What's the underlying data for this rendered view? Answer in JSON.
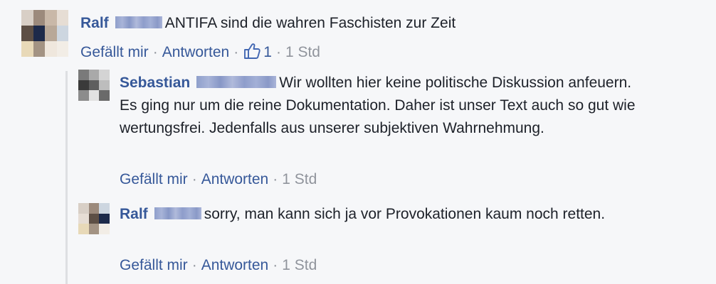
{
  "comments": [
    {
      "author": "Ralf",
      "text": "ANTIFA sind die wahren Faschisten zur Zeit",
      "actions": {
        "like": "Gefällt mir",
        "reply": "Antworten",
        "like_count": "1",
        "time": "1 Std"
      },
      "avatar_colors": [
        "#d8cfc6",
        "#9c8a7c",
        "#c9b8a8",
        "#e6ddd4",
        "#5d4f45",
        "#1d2a4a",
        "#b8a898",
        "#cdd6e0",
        "#e8d9b8",
        "#a39383",
        "#efe7dd",
        "#f2ede6"
      ]
    },
    {
      "author": "Sebastian",
      "text": "Wir wollten hier keine politische Diskussion anfeuern. Es ging nur um die reine Dokumentation. Daher ist unser Text auch so gut wie wertungsfrei. Jedenfalls aus unserer subjektiven Wahrnehmung.",
      "actions": {
        "like": "Gefällt mir",
        "reply": "Antworten",
        "time": "1 Std"
      },
      "avatar_colors": [
        "#7a7a7a",
        "#a9a9a9",
        "#d4d4d4",
        "#3a3a3a",
        "#5f5f5f",
        "#bdbdbd",
        "#8c8c8c",
        "#e2e2e2",
        "#6a6a6a"
      ]
    },
    {
      "author": "Ralf",
      "text": "sorry, man kann sich ja vor Provokationen kaum noch retten.",
      "actions": {
        "like": "Gefällt mir",
        "reply": "Antworten",
        "time": "1 Std"
      },
      "avatar_colors": [
        "#d8cfc6",
        "#9c8a7c",
        "#cdd6e0",
        "#e6ddd4",
        "#5d4f45",
        "#1d2a4a",
        "#e8d9b8",
        "#a39383",
        "#f2ede6"
      ]
    }
  ]
}
